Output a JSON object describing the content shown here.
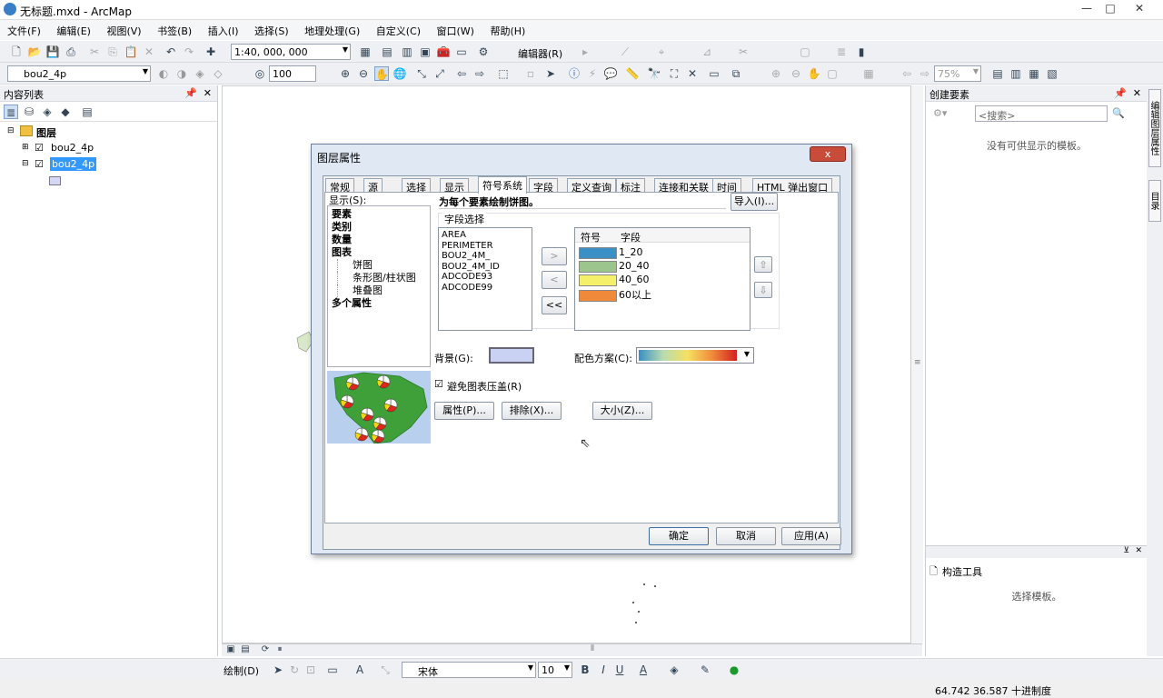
{
  "window": {
    "title": "无标题.mxd - ArcMap",
    "minimize": "—",
    "maximize": "□",
    "close": "✕"
  },
  "menu": [
    "文件(F)",
    "编辑(E)",
    "视图(V)",
    "书签(B)",
    "插入(I)",
    "选择(S)",
    "地理处理(G)",
    "自定义(C)",
    "窗口(W)",
    "帮助(H)"
  ],
  "toolbar": {
    "scale": "1:40, 000, 000",
    "editor_label": "编辑器(R)",
    "layer_select": "bou2_4p",
    "transparency": "100",
    "zoom_pct": "75%"
  },
  "toc": {
    "title": "内容列表",
    "root": "图层",
    "layers": [
      {
        "name": "bou2_4p",
        "checked": true,
        "selected": false
      },
      {
        "name": "bou2_4p",
        "checked": true,
        "selected": true
      }
    ],
    "swatch_color": "#d4d8f4"
  },
  "create_features": {
    "title": "创建要素",
    "search_placeholder": "<搜索>",
    "empty_msg": "没有可供显示的模板。"
  },
  "construct_tools": {
    "title": "构造工具",
    "msg": "选择模板。"
  },
  "side_tabs": [
    "编辑图层属性",
    "目录"
  ],
  "dialog": {
    "title": "图层属性",
    "close": "x",
    "tabs": [
      "常规",
      "源",
      "选择",
      "显示",
      "符号系统",
      "字段",
      "定义查询",
      "标注",
      "连接和关联",
      "时间",
      "HTML 弹出窗口"
    ],
    "active_tab": "符号系统",
    "show_label": "显示(S):",
    "show_items": [
      {
        "text": "要素",
        "level": 0
      },
      {
        "text": "类别",
        "level": 0
      },
      {
        "text": "数量",
        "level": 0
      },
      {
        "text": "图表",
        "level": 0
      },
      {
        "text": "饼图",
        "level": 1
      },
      {
        "text": "条形图/柱状图",
        "level": 1
      },
      {
        "text": "堆叠图",
        "level": 1
      },
      {
        "text": "多个属性",
        "level": 0
      }
    ],
    "heading": "为每个要素绘制饼图。",
    "import_btn": "导入(I)...",
    "field_group": "字段选择",
    "fields": [
      "AREA",
      "PERIMETER",
      "BOU2_4M_",
      "BOU2_4M_ID",
      "ADCODE93",
      "ADCODE99"
    ],
    "move_buttons": [
      ">",
      "<",
      "<<"
    ],
    "table_headers": {
      "symbol": "符号",
      "field": "字段"
    },
    "symbols": [
      {
        "color": "#3a8fc4",
        "label": "1_20"
      },
      {
        "color": "#9cc58e",
        "label": "20_40"
      },
      {
        "color": "#f5f06a",
        "label": "40_60"
      },
      {
        "color": "#f08a3a",
        "label": "60以上"
      }
    ],
    "up_arrow": "⇧",
    "down_arrow": "⇩",
    "background_label": "背景(G):",
    "background_color": "#c9d2f2",
    "colorscheme_label": "配色方案(C):",
    "avoid_overlap": "避免图表压盖(R)",
    "avoid_checked": true,
    "btn_properties": "属性(P)...",
    "btn_exclude": "排除(X)...",
    "btn_size": "大小(Z)...",
    "ok": "确定",
    "cancel": "取消",
    "apply": "应用(A)"
  },
  "bottom_toolbar": {
    "draw": "绘制(D)",
    "font": "宋体",
    "size": "10",
    "bold": "B",
    "italic": "I",
    "underline": "U",
    "font_color": "A"
  },
  "status": {
    "coords": "64.742  36.587 十进制度"
  }
}
